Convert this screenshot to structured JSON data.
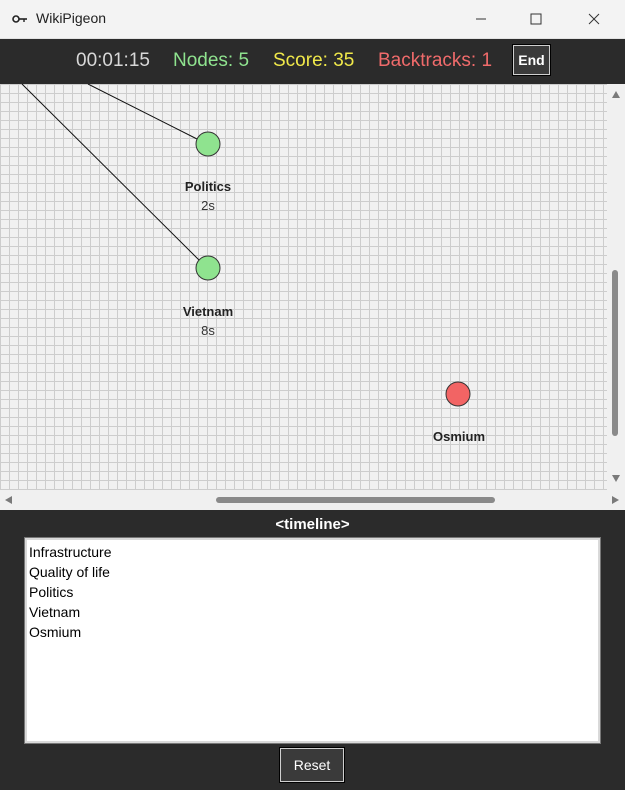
{
  "window": {
    "title": "WikiPigeon",
    "icons": {
      "app": "key-icon",
      "minimize": "minimize-icon",
      "maximize": "maximize-icon",
      "close": "close-icon"
    }
  },
  "status": {
    "time": "00:01:15",
    "nodes": "Nodes: 5",
    "score": "Score: 35",
    "backtracks": "Backtracks: 1",
    "end_label": "End",
    "colors": {
      "time": "#d8d8d8",
      "nodes": "#8fe38f",
      "score": "#f0e84a",
      "backtracks": "#f06b6b"
    }
  },
  "graph": {
    "node_colors": {
      "visited": "#8fe38f",
      "current": "#f26464"
    },
    "nodes": [
      {
        "label": "Politics",
        "time": "2s",
        "state": "visited"
      },
      {
        "label": "Vietnam",
        "time": "8s",
        "state": "visited"
      },
      {
        "label": "Osmium",
        "time": "",
        "state": "current"
      }
    ]
  },
  "timeline": {
    "title": "<timeline>",
    "items": [
      "Infrastructure",
      "Quality of life",
      "Politics",
      "Vietnam",
      "Osmium"
    ]
  },
  "controls": {
    "reset_label": "Reset"
  }
}
